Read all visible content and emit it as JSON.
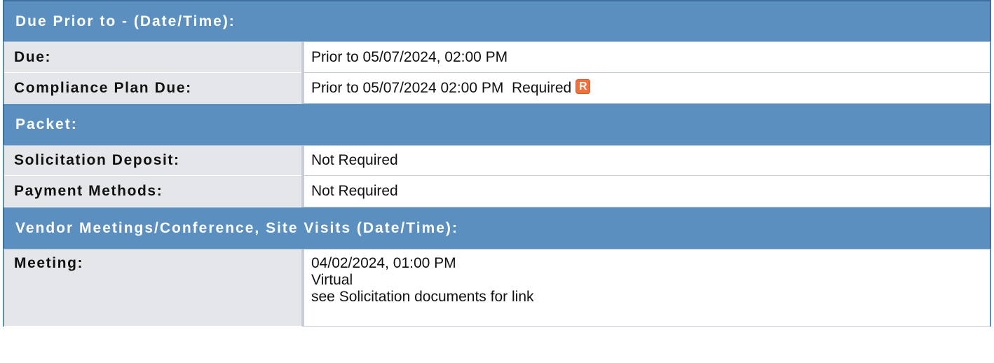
{
  "sections": {
    "due": {
      "header": "Due Prior to - (Date/Time):",
      "rows": [
        {
          "label": "Due:",
          "value": "Prior to 05/07/2024, 02:00 PM"
        },
        {
          "label": "Compliance Plan Due:",
          "value": "Prior to 05/07/2024 02:00 PM",
          "required_text": "Required",
          "required_icon": "R"
        }
      ]
    },
    "packet": {
      "header": "Packet:",
      "rows": [
        {
          "label": "Solicitation Deposit:",
          "value": "Not Required"
        },
        {
          "label": "Payment Methods:",
          "value": "Not Required"
        }
      ]
    },
    "meetings": {
      "header": "Vendor Meetings/Conference, Site Visits (Date/Time):",
      "rows": [
        {
          "label": "Meeting:",
          "lines": [
            "04/02/2024, 01:00 PM",
            "Virtual",
            "see Solicitation documents for link"
          ]
        }
      ]
    }
  },
  "colors": {
    "header_bg": "#5b8fc0",
    "label_bg": "#e4e6ea",
    "required_badge": "#f4703a"
  },
  "icons": {
    "required_badge": "required-r-icon"
  }
}
